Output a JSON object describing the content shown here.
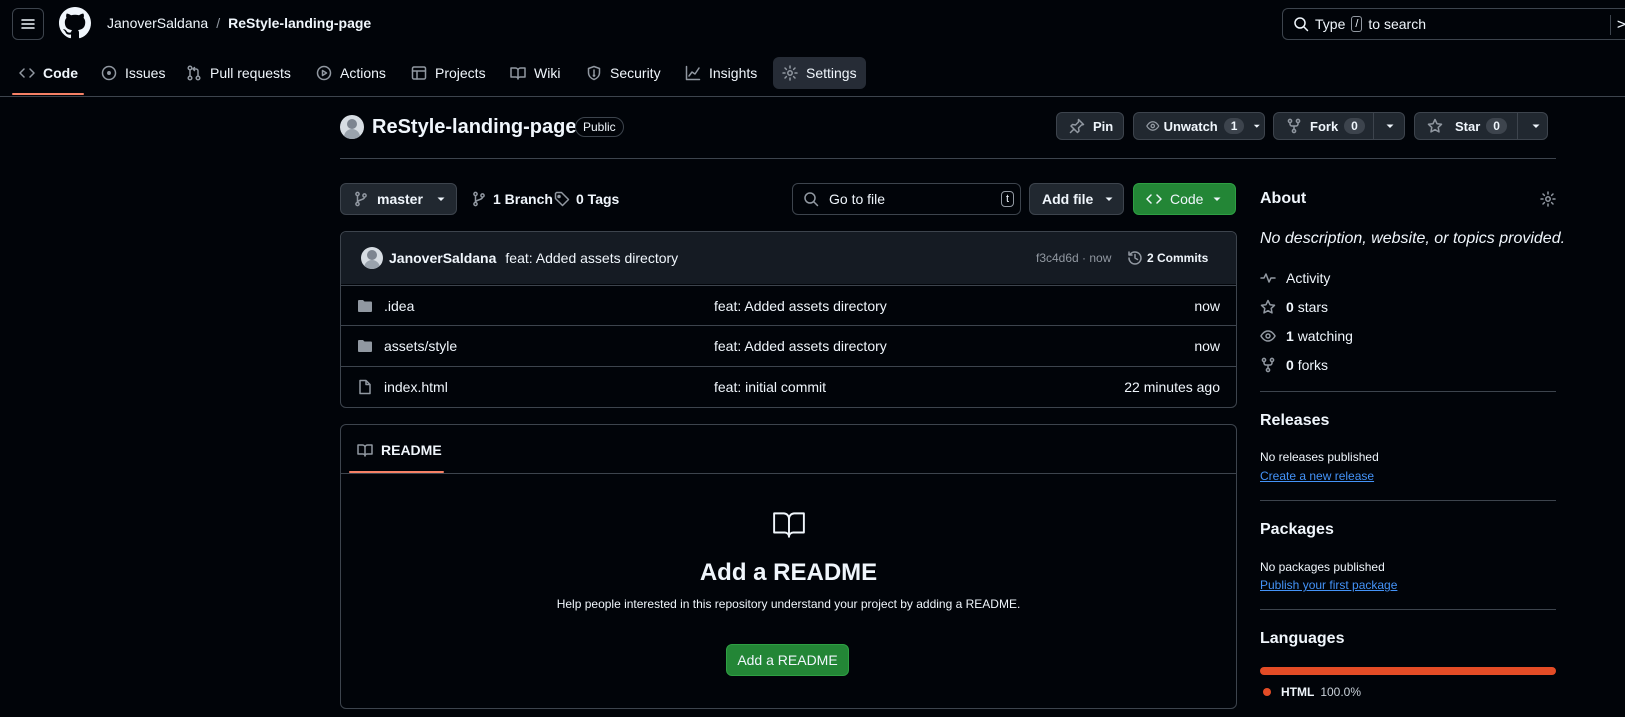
{
  "header": {
    "owner": "JanoverSaldana",
    "separator": "/",
    "repo": "ReStyle-landing-page",
    "search_prefix": "Type",
    "search_key": "/",
    "search_suffix": "to search"
  },
  "nav": {
    "tabs": [
      {
        "label": "Code",
        "icon": "code-icon"
      },
      {
        "label": "Issues",
        "icon": "issue-icon"
      },
      {
        "label": "Pull requests",
        "icon": "pull-request-icon"
      },
      {
        "label": "Actions",
        "icon": "play-icon"
      },
      {
        "label": "Projects",
        "icon": "table-icon"
      },
      {
        "label": "Wiki",
        "icon": "book-icon"
      },
      {
        "label": "Security",
        "icon": "shield-icon"
      },
      {
        "label": "Insights",
        "icon": "graph-icon"
      },
      {
        "label": "Settings",
        "icon": "gear-icon"
      }
    ]
  },
  "repo_header": {
    "name": "ReStyle-landing-page",
    "visibility": "Public",
    "pin_label": "Pin",
    "unwatch_label": "Unwatch",
    "unwatch_count": "1",
    "fork_label": "Fork",
    "fork_count": "0",
    "star_label": "Star",
    "star_count": "0"
  },
  "toolbar": {
    "branch": "master",
    "branches": "1 Branch",
    "tags": "0 Tags",
    "go_to_file": "Go to file",
    "go_to_file_key": "t",
    "add_file": "Add file",
    "code": "Code"
  },
  "commit": {
    "author": "JanoverSaldana",
    "message": "feat: Added assets directory",
    "hash_time": "f3c4d6d · now",
    "commits": "2 Commits"
  },
  "files": [
    {
      "name": ".idea",
      "type": "folder",
      "message": "feat: Added assets directory",
      "time": "now"
    },
    {
      "name": "assets/style",
      "type": "folder",
      "message": "feat: Added assets directory",
      "time": "now"
    },
    {
      "name": "index.html",
      "type": "file",
      "message": "feat: initial commit",
      "time": "22 minutes ago"
    }
  ],
  "readme": {
    "tab": "README",
    "title": "Add a README",
    "description": "Help people interested in this repository understand your project by adding a README.",
    "button": "Add a README"
  },
  "about": {
    "title": "About",
    "description": "No description, website, or topics provided.",
    "activity": "Activity",
    "stars_num": "0",
    "stars_label": "stars",
    "watching_num": "1",
    "watching_label": "watching",
    "forks_num": "0",
    "forks_label": "forks"
  },
  "releases": {
    "title": "Releases",
    "text": "No releases published",
    "link": "Create a new release"
  },
  "packages": {
    "title": "Packages",
    "text": "No packages published",
    "link": "Publish your first package"
  },
  "languages": {
    "title": "Languages",
    "items": [
      {
        "name": "HTML",
        "percent": "100.0%",
        "fraction": 1.0,
        "color": "#e34c26"
      }
    ]
  },
  "colors": {
    "accent_green": "#238636",
    "active_underline": "#f78166",
    "link": "#4493f8"
  }
}
